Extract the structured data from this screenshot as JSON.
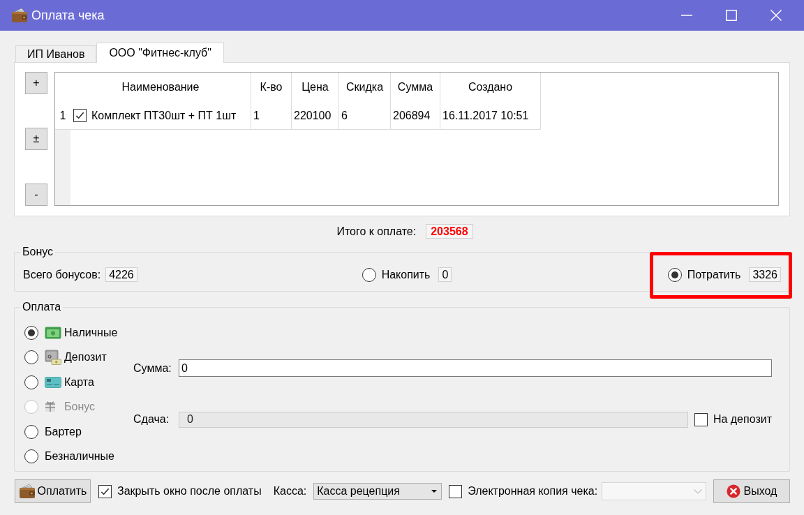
{
  "window": {
    "title": "Оплата чека"
  },
  "tabs": [
    {
      "label": "ИП Иванов",
      "selected": false
    },
    {
      "label": "ООО \"Фитнес-клуб\"",
      "selected": true
    }
  ],
  "side_buttons": [
    "+",
    "±",
    "-"
  ],
  "table": {
    "columns": [
      "Наименование",
      "К-во",
      "Цена",
      "Скидка",
      "Сумма",
      "Создано"
    ],
    "rows": [
      {
        "number": "1",
        "checked": true,
        "cells": [
          "Комплект ПТ30шт + ПТ 1шт",
          "1",
          "220100",
          "6",
          "206894",
          "16.11.2017 10:51"
        ]
      }
    ]
  },
  "total": {
    "label": "Итого к оплате:",
    "value": "203568"
  },
  "bonus": {
    "title": "Бонус",
    "balance": {
      "label": "Всего бонусов:",
      "value": "4226"
    },
    "options": [
      {
        "label": "Накопить",
        "value": "0",
        "selected": false,
        "highlighted": false
      },
      {
        "label": "Потратить",
        "value": "3326",
        "selected": true,
        "highlighted": true
      }
    ]
  },
  "payment": {
    "title": "Оплата",
    "methods": [
      {
        "kind": "cash",
        "label": "Наличные",
        "selected": true,
        "disabled": false
      },
      {
        "kind": "deposit",
        "label": "Депозит",
        "selected": false,
        "disabled": false
      },
      {
        "kind": "card",
        "label": "Карта",
        "selected": false,
        "disabled": false
      },
      {
        "kind": "bonus",
        "label": "Бонус",
        "selected": false,
        "disabled": true
      },
      {
        "kind": "barter",
        "label": "Бартер",
        "selected": false,
        "disabled": false
      },
      {
        "kind": "transfer",
        "label": "Безналичные",
        "selected": false,
        "disabled": false
      }
    ],
    "amount": {
      "label": "Сумма:",
      "value": "0",
      "disabled": false
    },
    "change": {
      "label": "Сдача:",
      "value": "0",
      "disabled": true
    },
    "to_deposit": {
      "label": "На депозит",
      "checked": false
    }
  },
  "footer": {
    "pay_button": "Оплатить",
    "close_after": {
      "label": "Закрыть окно после оплаты",
      "checked": true
    },
    "register": {
      "label": "Касса:",
      "value": "Касса рецепция"
    },
    "receipt_copy": {
      "label": "Электронная копия чека:",
      "checked": false,
      "field_disabled": true
    },
    "exit_button": "Выход"
  }
}
